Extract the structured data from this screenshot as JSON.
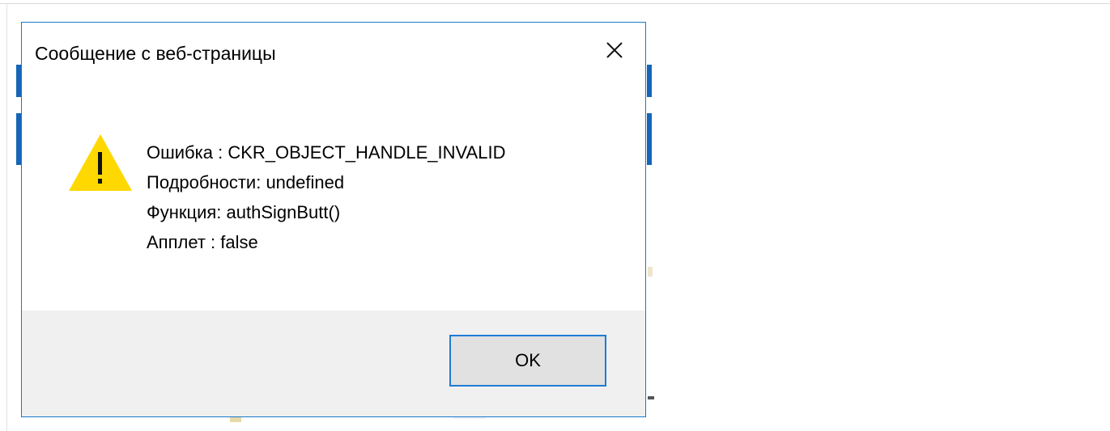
{
  "dialog": {
    "title": "Сообщение с веб-страницы",
    "close_icon": "close-icon",
    "warning_icon": "warning-icon",
    "accent_color": "#1979ca",
    "warning_color": "#ffd800",
    "message_lines": [
      "Ошибка : CKR_OBJECT_HANDLE_INVALID",
      "Подробности: undefined",
      "Функция: authSignButt()",
      "Апплет : false"
    ],
    "ok_label": "OK"
  }
}
